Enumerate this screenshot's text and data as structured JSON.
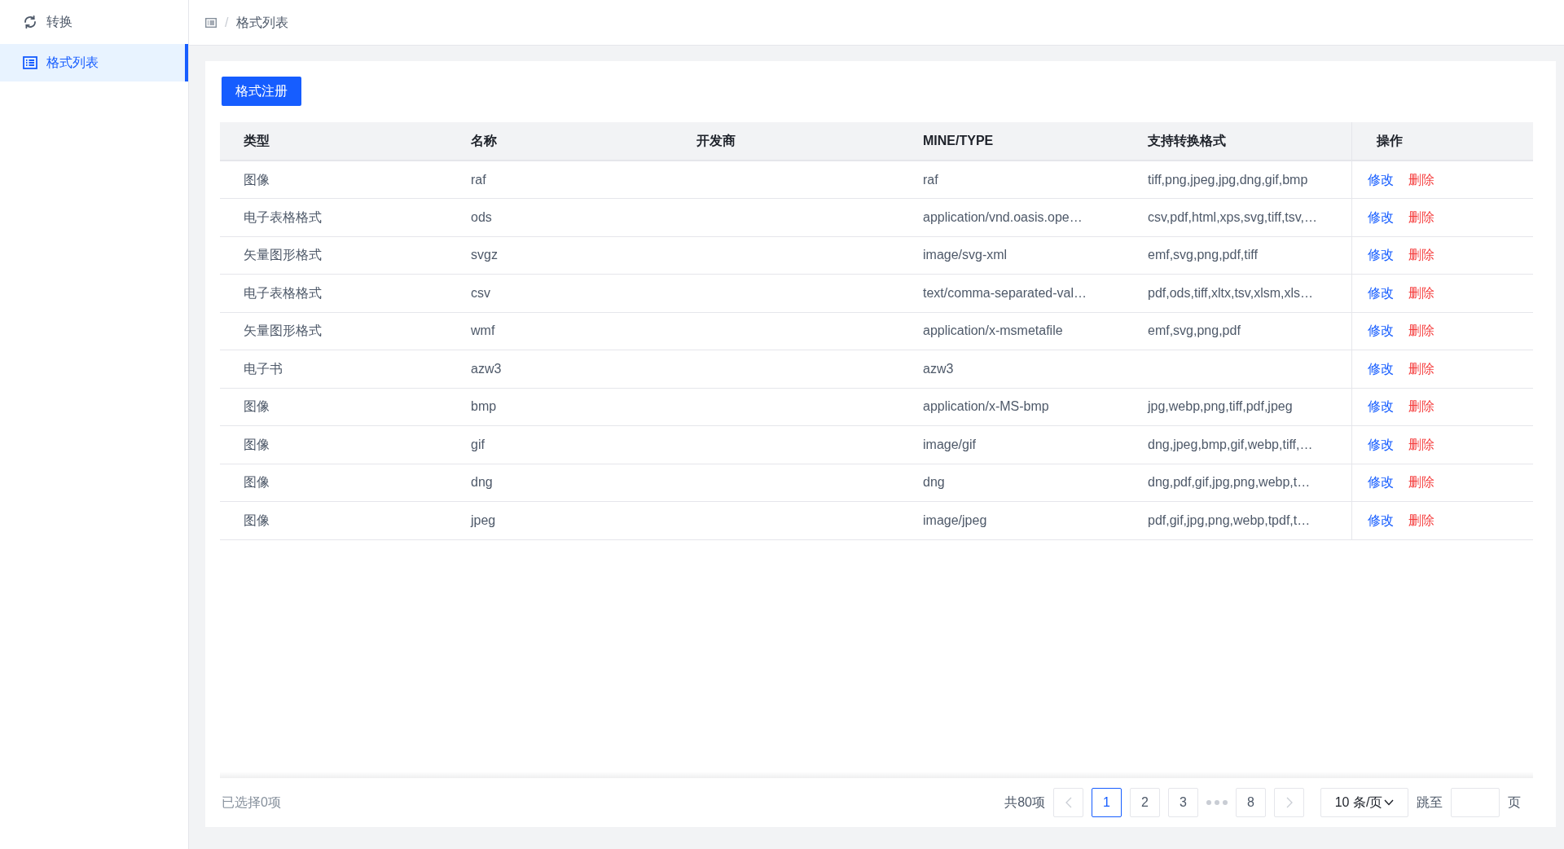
{
  "sidebar": {
    "items": [
      {
        "label": "转换",
        "selected": false
      },
      {
        "label": "格式列表",
        "selected": true
      }
    ]
  },
  "breadcrumb": {
    "separator": "/",
    "items": [
      "格式列表"
    ]
  },
  "register_button": "格式注册",
  "table": {
    "columns": [
      "类型",
      "名称",
      "开发商",
      "MINE/TYPE",
      "支持转换格式",
      "操作"
    ],
    "rows": [
      {
        "type": "图像",
        "name": "raf",
        "mime_type": "raf",
        "convertible_formats": "tiff,png,jpeg,jpg,dng,gif,bmp",
        "actions": [
          {
            "kind": "edit",
            "label": "修改"
          },
          {
            "kind": "delete",
            "label": "删除"
          }
        ]
      },
      {
        "type": "电子表格格式",
        "name": "ods",
        "mime_type": "application/vnd.oasis.ope…",
        "convertible_formats": "csv,pdf,html,xps,svg,tiff,tsv,…",
        "actions": [
          {
            "kind": "edit",
            "label": "修改"
          },
          {
            "kind": "delete",
            "label": "删除"
          }
        ]
      },
      {
        "type": "矢量图形格式",
        "name": "svgz",
        "mime_type": "image/svg-xml",
        "convertible_formats": "emf,svg,png,pdf,tiff",
        "actions": [
          {
            "kind": "edit",
            "label": "修改"
          },
          {
            "kind": "delete",
            "label": "删除"
          }
        ]
      },
      {
        "type": "电子表格格式",
        "name": "csv",
        "mime_type": "text/comma-separated-val…",
        "convertible_formats": "pdf,ods,tiff,xltx,tsv,xlsm,xls…",
        "actions": [
          {
            "kind": "edit",
            "label": "修改"
          },
          {
            "kind": "delete",
            "label": "删除"
          }
        ]
      },
      {
        "type": "矢量图形格式",
        "name": "wmf",
        "mime_type": "application/x-msmetafile",
        "convertible_formats": "emf,svg,png,pdf",
        "actions": [
          {
            "kind": "edit",
            "label": "修改"
          },
          {
            "kind": "delete",
            "label": "删除"
          }
        ]
      },
      {
        "type": "电子书",
        "name": "azw3",
        "mime_type": "azw3",
        "actions": [
          {
            "kind": "edit",
            "label": "修改"
          },
          {
            "kind": "delete",
            "label": "删除"
          }
        ]
      },
      {
        "type": "图像",
        "name": "bmp",
        "mime_type": "application/x-MS-bmp",
        "convertible_formats": "jpg,webp,png,tiff,pdf,jpeg",
        "actions": [
          {
            "kind": "edit",
            "label": "修改"
          },
          {
            "kind": "delete",
            "label": "删除"
          }
        ]
      },
      {
        "type": "图像",
        "name": "gif",
        "mime_type": "image/gif",
        "convertible_formats": "dng,jpeg,bmp,gif,webp,tiff,…",
        "actions": [
          {
            "kind": "edit",
            "label": "修改"
          },
          {
            "kind": "delete",
            "label": "删除"
          }
        ]
      },
      {
        "type": "图像",
        "name": "dng",
        "mime_type": "dng",
        "convertible_formats": "dng,pdf,gif,jpg,png,webp,t…",
        "actions": [
          {
            "kind": "edit",
            "label": "修改"
          },
          {
            "kind": "delete",
            "label": "删除"
          }
        ]
      },
      {
        "type": "图像",
        "name": "jpeg",
        "mime_type": "image/jpeg",
        "convertible_formats": "pdf,gif,jpg,png,webp,tpdf,t…",
        "actions": [
          {
            "kind": "edit",
            "label": "修改"
          },
          {
            "kind": "delete",
            "label": "删除"
          }
        ]
      }
    ]
  },
  "footer": {
    "selected_count": "已选择0项",
    "total": "共80项",
    "pages": [
      {
        "kind": "page",
        "label": "1",
        "selected": true
      },
      {
        "kind": "page",
        "label": "2",
        "selected": false
      },
      {
        "kind": "page",
        "label": "3",
        "selected": false
      },
      {
        "kind": "ellipsis"
      },
      {
        "kind": "page",
        "label": "8",
        "selected": false
      }
    ],
    "page_size": "10 条/页",
    "jump_label": "跳至",
    "page_suffix": "页"
  }
}
